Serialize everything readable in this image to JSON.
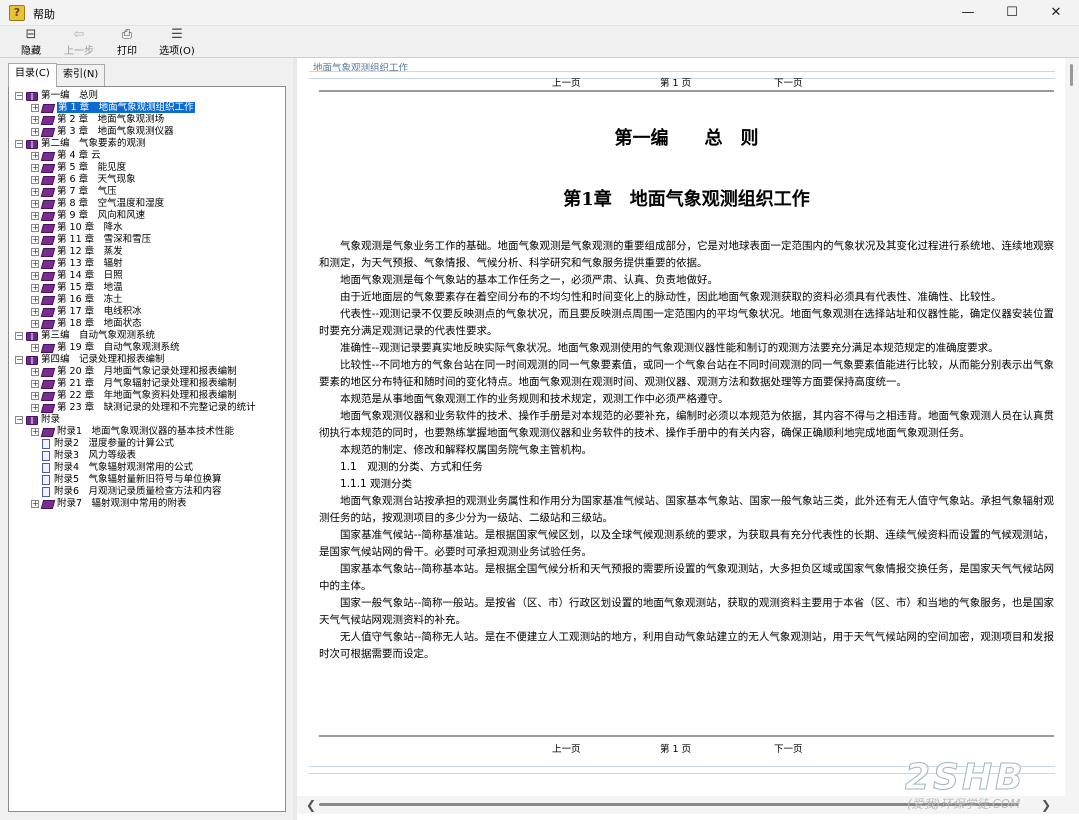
{
  "window": {
    "title": "帮助",
    "controls": {
      "minimize": "—",
      "maximize": "☐",
      "close": "✕"
    }
  },
  "toolbar": {
    "buttons": [
      {
        "label": "隐藏",
        "icon": "hide-pane-icon",
        "glyph": "⊟",
        "enabled": true
      },
      {
        "label": "上一步",
        "icon": "back-arrow-icon",
        "glyph": "⇦",
        "enabled": false
      },
      {
        "label": "打印",
        "icon": "printer-icon",
        "glyph": "⎙",
        "enabled": true
      },
      {
        "label": "选项(O)",
        "icon": "options-icon",
        "glyph": "☰",
        "enabled": true
      }
    ]
  },
  "tabs": [
    {
      "label": "目录(C)",
      "active": true
    },
    {
      "label": "索引(N)",
      "active": false
    }
  ],
  "tree": [
    {
      "label": "第一编　总则",
      "level": 0,
      "type": "book-open",
      "expander": "−"
    },
    {
      "label": "第 1 章　地面气象观测组织工作",
      "level": 1,
      "type": "book",
      "expander": "+",
      "selected": true
    },
    {
      "label": "第 2 章　地面气象观测场",
      "level": 1,
      "type": "book",
      "expander": "+"
    },
    {
      "label": "第 3 章　地面气象观测仪器",
      "level": 1,
      "type": "book",
      "expander": "+"
    },
    {
      "label": "第二编　气象要素的观测",
      "level": 0,
      "type": "book-open",
      "expander": "−"
    },
    {
      "label": "第 4 章 云",
      "level": 1,
      "type": "book",
      "expander": "+"
    },
    {
      "label": "第 5 章　能见度",
      "level": 1,
      "type": "book",
      "expander": "+"
    },
    {
      "label": "第 6 章　天气现象",
      "level": 1,
      "type": "book",
      "expander": "+"
    },
    {
      "label": "第 7 章　气压",
      "level": 1,
      "type": "book",
      "expander": "+"
    },
    {
      "label": "第 8 章　空气温度和湿度",
      "level": 1,
      "type": "book",
      "expander": "+"
    },
    {
      "label": "第 9 章　风向和风速",
      "level": 1,
      "type": "book",
      "expander": "+"
    },
    {
      "label": "第 10 章　降水",
      "level": 1,
      "type": "book",
      "expander": "+"
    },
    {
      "label": "第 11 章　雪深和雪压",
      "level": 1,
      "type": "book",
      "expander": "+"
    },
    {
      "label": "第 12 章　蒸发",
      "level": 1,
      "type": "book",
      "expander": "+"
    },
    {
      "label": "第 13 章　辐射",
      "level": 1,
      "type": "book",
      "expander": "+"
    },
    {
      "label": "第 14 章　日照",
      "level": 1,
      "type": "book",
      "expander": "+"
    },
    {
      "label": "第 15 章　地温",
      "level": 1,
      "type": "book",
      "expander": "+"
    },
    {
      "label": "第 16 章　冻土",
      "level": 1,
      "type": "book",
      "expander": "+"
    },
    {
      "label": "第 17 章　电线积冰",
      "level": 1,
      "type": "book",
      "expander": "+"
    },
    {
      "label": "第 18 章　地面状态",
      "level": 1,
      "type": "book",
      "expander": "+"
    },
    {
      "label": "第三编　自动气象观测系统",
      "level": 0,
      "type": "book-open",
      "expander": "−"
    },
    {
      "label": "第 19 章　自动气象观测系统",
      "level": 1,
      "type": "book",
      "expander": "+"
    },
    {
      "label": "第四编　记录处理和报表编制",
      "level": 0,
      "type": "book-open",
      "expander": "−"
    },
    {
      "label": "第 20 章　月地面气象记录处理和报表编制",
      "level": 1,
      "type": "book",
      "expander": "+"
    },
    {
      "label": "第 21 章　月气象辐射记录处理和报表编制",
      "level": 1,
      "type": "book",
      "expander": "+"
    },
    {
      "label": "第 22 章　年地面气象资料处理和报表编制",
      "level": 1,
      "type": "book",
      "expander": "+"
    },
    {
      "label": "第 23 章　缺测记录的处理和不完整记录的统计",
      "level": 1,
      "type": "book",
      "expander": "+"
    },
    {
      "label": "附录",
      "level": 0,
      "type": "book-open",
      "expander": "−"
    },
    {
      "label": "附录1　地面气象观测仪器的基本技术性能",
      "level": 1,
      "type": "book",
      "expander": "+"
    },
    {
      "label": "附录2　湿度参量的计算公式",
      "level": 1,
      "type": "page",
      "expander": ""
    },
    {
      "label": "附录3　风力等级表",
      "level": 1,
      "type": "page",
      "expander": ""
    },
    {
      "label": "附录4　气象辐射观测常用的公式",
      "level": 1,
      "type": "page",
      "expander": ""
    },
    {
      "label": "附录5　气象辐射量新旧符号与单位换算",
      "level": 1,
      "type": "page",
      "expander": ""
    },
    {
      "label": "附录6　月观测记录质量检查方法和内容",
      "level": 1,
      "type": "page",
      "expander": ""
    },
    {
      "label": "附录7　辐射观测中常用的附表",
      "level": 1,
      "type": "book",
      "expander": "+"
    }
  ],
  "content": {
    "breadcrumb": "地面气象观测组织工作",
    "nav": {
      "prev": "上一页",
      "page": "第 1 页",
      "next": "下一页"
    },
    "part_title": "第一编　　总　则",
    "chapter_title": "第1章　地面气象观测组织工作",
    "paragraphs": [
      "气象观测是气象业务工作的基础。地面气象观测是气象观测的重要组成部分，它是对地球表面一定范围内的气象状况及其变化过程进行系统地、连续地观察和测定，为天气预报、气象情报、气候分析、科学研究和气象服务提供重要的依据。",
      "地面气象观测是每个气象站的基本工作任务之一，必须严肃、认真、负责地做好。",
      "由于近地面层的气象要素存在着空间分布的不均匀性和时间变化上的脉动性，因此地面气象观测获取的资料必须具有代表性、准确性、比较性。",
      "代表性--观测记录不仅要反映测点的气象状况，而且要反映测点周围一定范围内的平均气象状况。地面气象观测在选择站址和仪器性能，确定仪器安装位置时要充分满足观测记录的代表性要求。",
      "准确性--观测记录要真实地反映实际气象状况。地面气象观测使用的气象观测仪器性能和制订的观测方法要充分满足本规范规定的准确度要求。",
      "比较性--不同地方的气象台站在同一时间观测的同一气象要素值，或同一个气象台站在不同时间观测的同一气象要素值能进行比较，从而能分别表示出气象要素的地区分布特征和随时间的变化特点。地面气象观测在观测时间、观测仪器、观测方法和数据处理等方面要保持高度统一。",
      "本规范是从事地面气象观测工作的业务规则和技术规定，观测工作中必须严格遵守。",
      "地面气象观测仪器和业务软件的技术、操作手册是对本规范的必要补充，编制时必须以本规范为依据，其内容不得与之相违背。地面气象观测人员在认真贯彻执行本规范的同时，也要熟练掌握地面气象观测仪器和业务软件的技术、操作手册中的有关内容，确保正确顺利地完成地面气象观测任务。",
      "本规范的制定、修改和解释权属国务院气象主管机构。",
      "1.1　观测的分类、方式和任务",
      "1.1.1 观测分类",
      "地面气象观测台站按承担的观测业务属性和作用分为国家基准气候站、国家基本气象站、国家一般气象站三类，此外还有无人值守气象站。承担气象辐射观测任务的站，按观测项目的多少分为一级站、二级站和三级站。",
      "国家基准气候站--简称基准站。是根据国家气候区划，以及全球气候观测系统的要求，为获取具有充分代表性的长期、连续气候资料而设置的气候观测站，是国家气候站网的骨干。必要时可承担观测业务试验任务。",
      "国家基本气象站--简称基本站。是根据全国气候分析和天气预报的需要所设置的气象观测站，大多担负区域或国家气象情报交换任务，是国家天气气候站网中的主体。",
      "国家一般气象站--简称一般站。是按省（区、市）行政区划设置的地面气象观测站，获取的观测资料主要用于本省（区、市）和当地的气象服务，也是国家天气气候站网观测资料的补充。",
      "无人值守气象站--简称无人站。是在不便建立人工观测站的地方，利用自动气象站建立的无人气象观测站，用于天气气候站网的空间加密，观测项目和发报时次可根据需要而设定。"
    ]
  },
  "scrollbars": {
    "left_arrow": "❮",
    "right_arrow": "❯"
  },
  "watermark": {
    "brand": "2SHB",
    "tagline": "(爱我)环保学徒.COM"
  }
}
